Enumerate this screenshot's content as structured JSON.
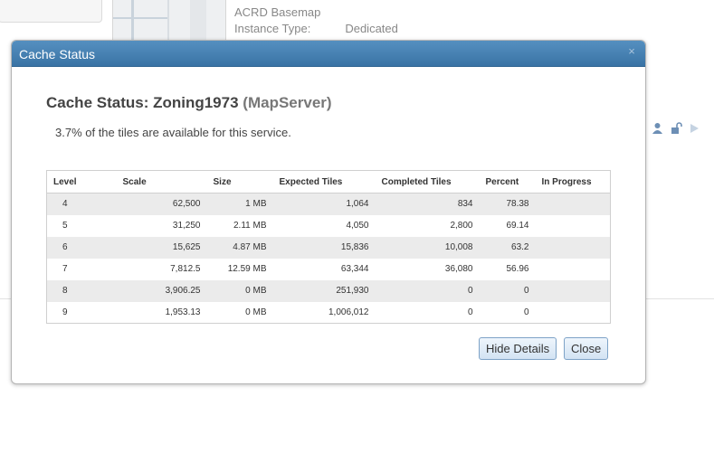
{
  "background": {
    "basemap_label": "ACRD Basemap",
    "instance_type_label": "Instance Type:",
    "instance_type_value": "Dedicated"
  },
  "modal": {
    "title": "Cache Status",
    "close_glyph": "×",
    "heading_prefix": "Cache Status: Zoning1973",
    "heading_suffix": "(MapServer)",
    "summary": "3.7% of the tiles are available for this service.",
    "hide_details_label": "Hide Details",
    "close_label": "Close"
  },
  "table": {
    "headers": [
      "Level",
      "Scale",
      "Size",
      "Expected Tiles",
      "Completed Tiles",
      "Percent",
      "In Progress"
    ],
    "rows": [
      {
        "level": "4",
        "scale": "62,500",
        "size": "1 MB",
        "expected": "1,064",
        "completed": "834",
        "percent": "78.38",
        "in_progress": ""
      },
      {
        "level": "5",
        "scale": "31,250",
        "size": "2.11 MB",
        "expected": "4,050",
        "completed": "2,800",
        "percent": "69.14",
        "in_progress": ""
      },
      {
        "level": "6",
        "scale": "15,625",
        "size": "4.87 MB",
        "expected": "15,836",
        "completed": "10,008",
        "percent": "63.2",
        "in_progress": ""
      },
      {
        "level": "7",
        "scale": "7,812.5",
        "size": "12.59 MB",
        "expected": "63,344",
        "completed": "36,080",
        "percent": "56.96",
        "in_progress": ""
      },
      {
        "level": "8",
        "scale": "3,906.25",
        "size": "0 MB",
        "expected": "251,930",
        "completed": "0",
        "percent": "0",
        "in_progress": ""
      },
      {
        "level": "9",
        "scale": "1,953.13",
        "size": "0 MB",
        "expected": "1,006,012",
        "completed": "0",
        "percent": "0",
        "in_progress": ""
      }
    ]
  },
  "colors": {
    "titlebar": "#3a73a5",
    "row_stripe": "#ebebeb",
    "button_border": "#7ea3c7"
  },
  "icons": [
    "user-icon",
    "unlock-icon",
    "play-icon"
  ]
}
